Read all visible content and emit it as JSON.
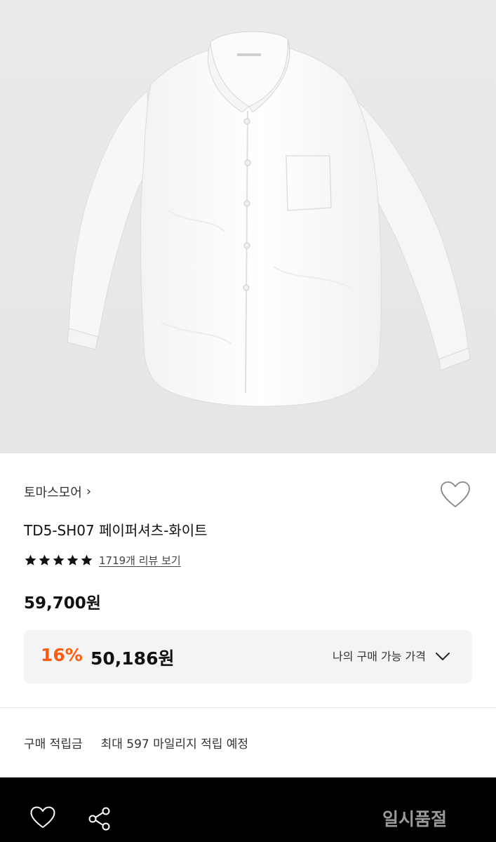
{
  "product": {
    "brand": "토마스모어",
    "brand_chevron": "›",
    "title": "TD5-SH07 페이퍼셔츠-화이트",
    "rating_stars": 5,
    "review_link": "1719개 리뷰 보기",
    "price": "59,700원"
  },
  "discount": {
    "percent": "16%",
    "price": "50,186원",
    "my_price_label": "나의 구매 가능 가격"
  },
  "mileage": {
    "label": "구매 적립금",
    "value": "최대 597 마일리지 적립 예정"
  },
  "bottom_bar": {
    "status": "일시품절"
  },
  "icons": {
    "wishlist": "heart-icon",
    "share": "share-icon",
    "expand": "chevron-down-icon",
    "star": "star-icon"
  },
  "colors": {
    "discount_accent": "#ff5b0e",
    "hero_background": "#ececec",
    "bottom_bar": "#000000",
    "sold_out_text": "#9a9a9a"
  }
}
